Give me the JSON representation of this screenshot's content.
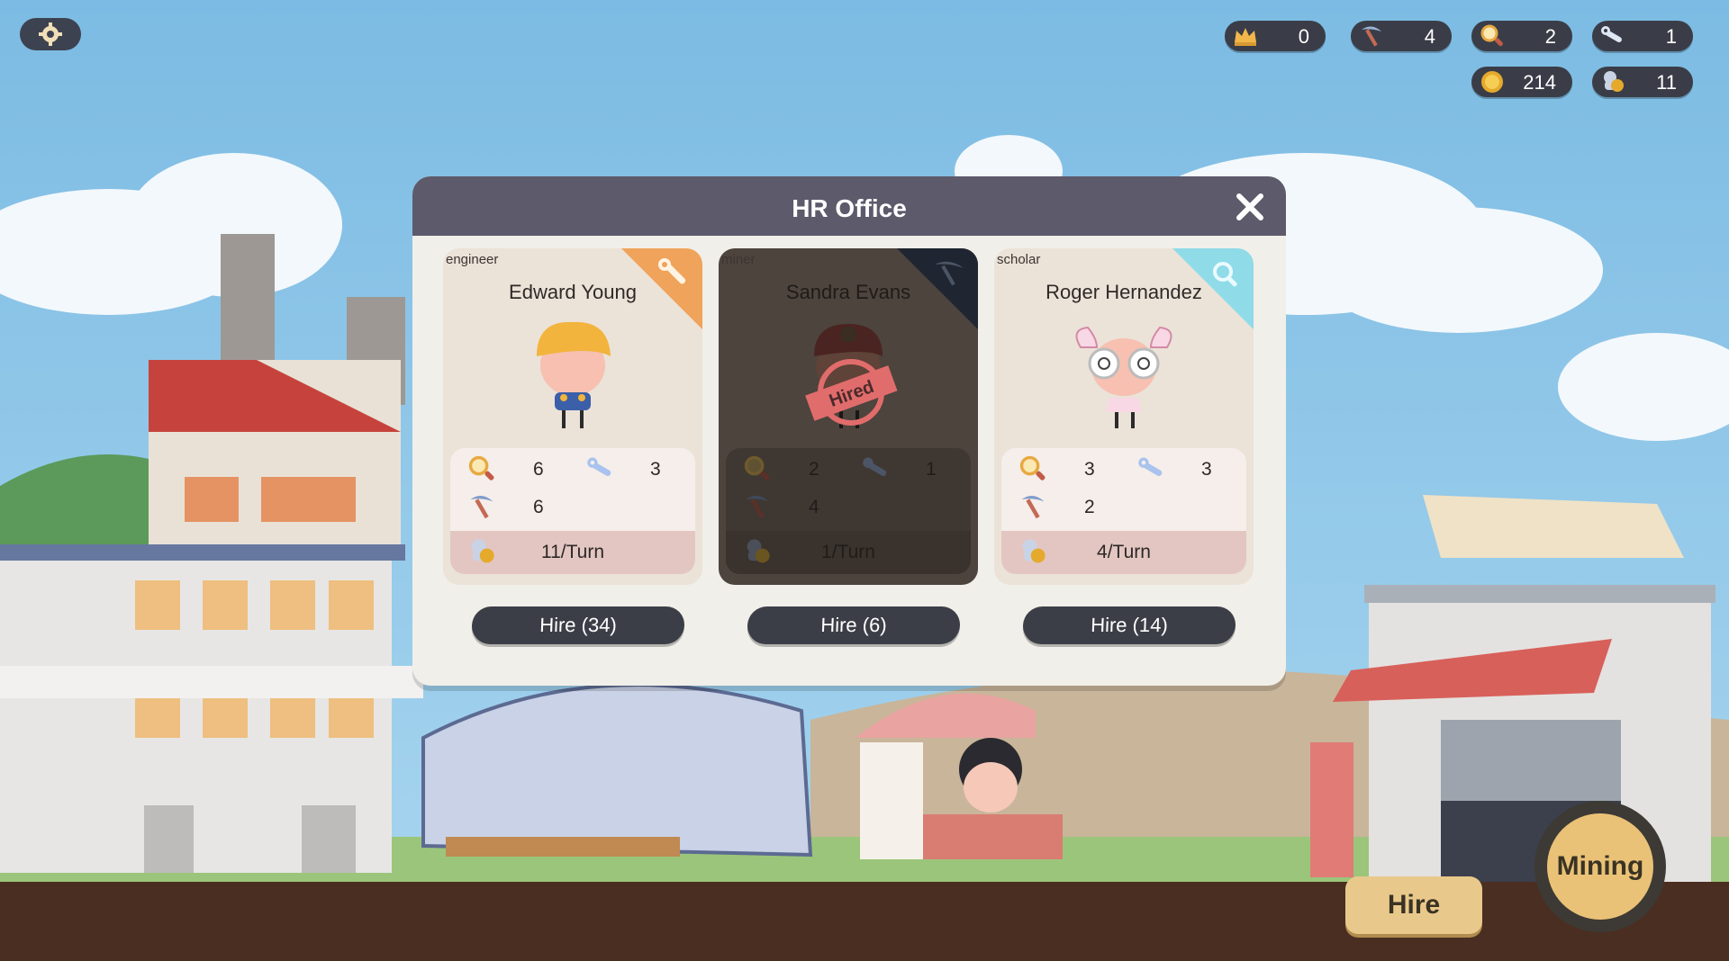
{
  "hud": {
    "crowns": "0",
    "pickaxes": "4",
    "magnifiers": "2",
    "wrenches": "1",
    "coins": "214",
    "workers_pay": "11"
  },
  "modal": {
    "title": "HR Office"
  },
  "candidates": [
    {
      "role": "engineer",
      "name": "Edward Young",
      "research": "6",
      "engineering": "3",
      "mining": "6",
      "salary": "11/Turn",
      "hire_label": "Hire (34)",
      "hired": false,
      "accent": "#f0a35a"
    },
    {
      "role": "miner",
      "name": "Sandra Evans",
      "research": "2",
      "engineering": "1",
      "mining": "4",
      "salary": "1/Turn",
      "hire_label": "Hire (6)",
      "hired": true,
      "stamp": "Hired",
      "accent": "#2d3540"
    },
    {
      "role": "scholar",
      "name": "Roger Hernandez",
      "research": "3",
      "engineering": "3",
      "mining": "2",
      "salary": "4/Turn",
      "hire_label": "Hire (14)",
      "hired": false,
      "accent": "#8fdbe8"
    }
  ],
  "buttons": {
    "hire": "Hire",
    "mining": "Mining"
  },
  "icons": [
    "settings-gear-icon",
    "crown-icon",
    "pickaxe-icon",
    "magnifier-icon",
    "wrench-icon",
    "coin-icon",
    "worker-coin-icon",
    "close-icon"
  ]
}
